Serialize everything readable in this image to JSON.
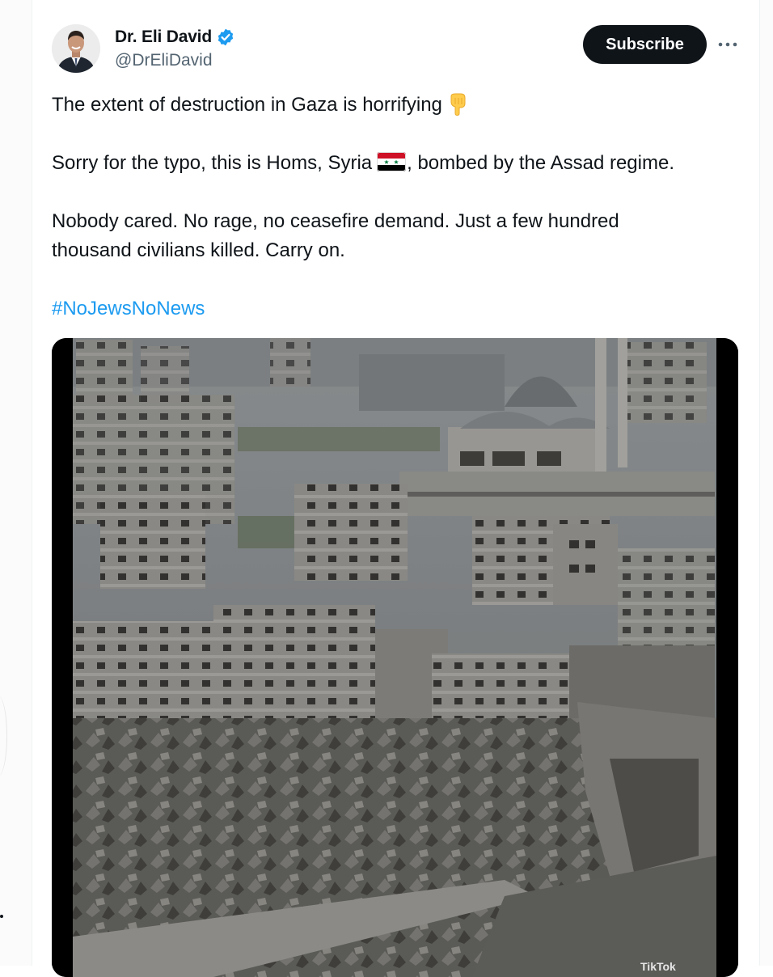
{
  "author": {
    "display_name": "Dr. Eli David",
    "handle": "@DrEliDavid",
    "verified": true
  },
  "actions": {
    "subscribe_label": "Subscribe",
    "more_icon": "more-horizontal-icon"
  },
  "tweet": {
    "line1": "The extent of destruction in Gaza is horrifying",
    "line2_before_flag": "Sorry for the typo, this is Homs, Syria",
    "line2_after_flag": ", bombed by the Assad regime.",
    "line3": "Nobody cared. No rage, no ceasefire demand. Just a few hundred",
    "line4": "thousand civilians killed. Carry on.",
    "hashtag": "#NoJewsNoNews",
    "emojis": [
      "backhand-index-pointing-down",
      "flag-syria"
    ]
  },
  "media": {
    "type": "video",
    "watermark": "TikTok"
  },
  "colors": {
    "text": "#0f1419",
    "secondary": "#536471",
    "link": "#1d9bf0",
    "verified": "#1d9bf0",
    "button_bg": "#0f1419"
  }
}
